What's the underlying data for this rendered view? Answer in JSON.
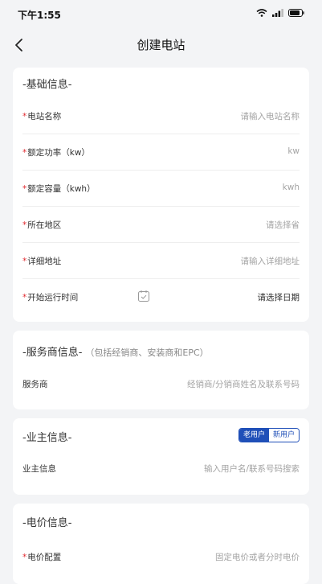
{
  "status_bar": {
    "time": "下午1:55"
  },
  "nav": {
    "title": "创建电站"
  },
  "basic_info": {
    "title": "-基础信息-",
    "rows": [
      {
        "label": "电站名称",
        "required_mark": "*",
        "placeholder": "请输入电站名称"
      },
      {
        "label": "额定功率（kw）",
        "required_mark": "*",
        "placeholder": "kw"
      },
      {
        "label": "额定容量（kwh）",
        "required_mark": "*",
        "placeholder": "kwh"
      },
      {
        "label": "所在地区",
        "required_mark": "*",
        "placeholder": "请选择省"
      },
      {
        "label": "详细地址",
        "required_mark": "*",
        "placeholder": "请输入详细地址"
      },
      {
        "label": "开始运行时间",
        "required_mark": "*",
        "value": "请选择日期"
      }
    ]
  },
  "service_info": {
    "title": "-服务商信息-",
    "subtitle": "（包括经销商、安装商和EPC）",
    "rows": [
      {
        "label": "服务商",
        "placeholder": "经销商/分销商姓名及联系号码"
      }
    ]
  },
  "owner_info": {
    "title": "-业主信息-",
    "toggle": {
      "old_user": "老用户",
      "new_user": "新用户",
      "selected": "老用户"
    },
    "rows": [
      {
        "label": "业主信息",
        "placeholder": "输入用户名/联系号码搜索"
      }
    ]
  },
  "price_info": {
    "title": "-电价信息-",
    "rows": [
      {
        "label": "电价配置",
        "required_mark": "*",
        "placeholder": "固定电价或者分时电价"
      }
    ]
  },
  "colors": {
    "accent": "#1f4fb8",
    "required": "#e0282e",
    "background": "#f3f4f6"
  },
  "icons": [
    "wifi-icon",
    "signal-icon",
    "battery-icon",
    "back-icon",
    "calendar-icon"
  ]
}
